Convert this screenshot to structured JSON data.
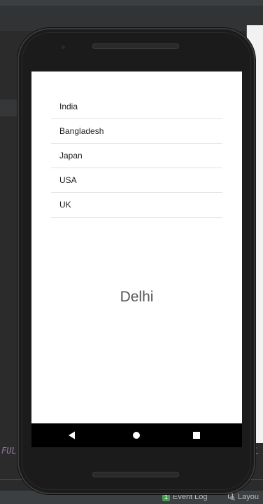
{
  "list": {
    "items": [
      "India",
      "Bangladesh",
      "Japan",
      "USA",
      "UK"
    ]
  },
  "display": {
    "text": "Delhi"
  },
  "ide": {
    "code_fragment_left": "FULL",
    "code_fragment_right": "FL",
    "status": {
      "event_log_count": "1",
      "event_log_label": "Event Log",
      "layout_label": "Layou"
    }
  },
  "nav": {
    "icons": [
      "back-icon",
      "home-icon",
      "recents-icon"
    ]
  }
}
